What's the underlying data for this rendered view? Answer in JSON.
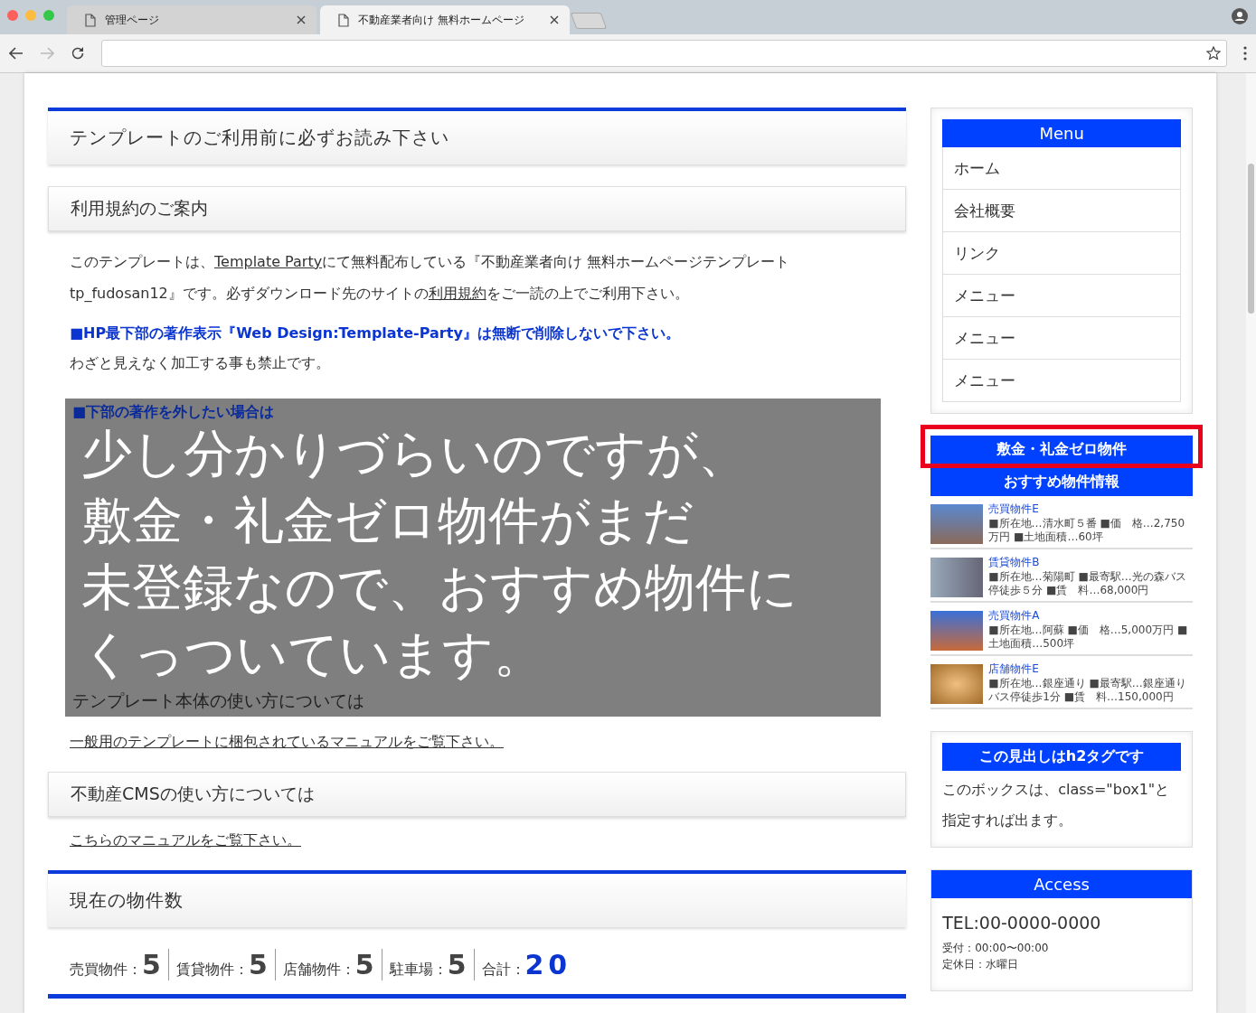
{
  "browser": {
    "tabs": [
      {
        "title": "管理ページ",
        "selected": false
      },
      {
        "title": "不動産業者向け 無料ホームページ",
        "selected": true
      }
    ]
  },
  "main": [
    {
      "kind": "h2",
      "text": "テンプレートのご利用前に必ずお読み下さい"
    },
    {
      "kind": "h3",
      "text": "利用規約のご案内"
    },
    {
      "kind": "p",
      "parts": [
        {
          "text": "このテンプレートは、",
          "link": false
        },
        {
          "text": "Template Party",
          "link": true
        },
        {
          "text": "にて無料配布している『不動産業者向け 無料ホームページテンプレート tp_fudosan12』です。必ずダウンロード先のサイトの",
          "link": false
        },
        {
          "text": "利用規約",
          "link": true
        },
        {
          "text": "をご一読の上でご利用下さい。",
          "link": false
        }
      ]
    },
    {
      "kind": "notice",
      "text": "■HP最下部の著作表示『Web Design:Template-Party』は無断で削除しないで下さい。"
    },
    {
      "kind": "p",
      "parts": [
        {
          "text": "わざと見えなく加工する事も禁止です。",
          "link": false
        }
      ]
    },
    {
      "kind": "overlay",
      "notice": "■下部の著作を外したい場合は",
      "heading": "テンプレート本体の使い方については",
      "caption": [
        "少し分かりづらいのですが、",
        "敷金・礼金ゼロ物件がまだ",
        "未登録なので、おすすめ物件に",
        "くっついています。"
      ]
    },
    {
      "kind": "link",
      "text": "一般用のテンプレートに梱包されているマニュアルをご覧下さい。"
    },
    {
      "kind": "h3",
      "text": "不動産CMSの使い方については"
    },
    {
      "kind": "link",
      "text": "こちらのマニュアルをご覧下さい。"
    },
    {
      "kind": "h2",
      "text": "現在の物件数"
    },
    {
      "kind": "stats",
      "items": [
        {
          "label": "売買物件：",
          "value": "5",
          "total": false
        },
        {
          "label": "賃貸物件：",
          "value": "5",
          "total": false
        },
        {
          "label": "店舗物件：",
          "value": "5",
          "total": false
        },
        {
          "label": "駐車場：",
          "value": "5",
          "total": false
        },
        {
          "label": "合計：",
          "value": "20",
          "total": true
        }
      ]
    }
  ],
  "sidebar": {
    "menu": {
      "title": "Menu",
      "items": [
        "ホーム",
        "会社概要",
        "リンク",
        "メニュー",
        "メニュー",
        "メニュー"
      ]
    },
    "featured": {
      "title": "敷金・礼金ゼロ物件",
      "highlighted": true
    },
    "recommended": {
      "title": "おすすめ物件情報",
      "items": [
        {
          "name": "売買物件E",
          "detail": "■所在地…清水町５番 ■価　格…2,750万円 ■土地面積…60坪"
        },
        {
          "name": "賃貸物件B",
          "detail": "■所在地…菊陽町 ■最寄駅…光の森バス停徒歩５分 ■賃　料…68,000円"
        },
        {
          "name": "売買物件A",
          "detail": "■所在地…阿蘇 ■価　格…5,000万円 ■土地面積…500坪"
        },
        {
          "name": "店舗物件E",
          "detail": "■所在地…銀座通り ■最寄駅…銀座通りバス停徒歩1分 ■賃　料…150,000円"
        }
      ]
    },
    "box1": {
      "title": "この見出しはh2タグです",
      "text": "このボックスは、class=\"box1\"と指定すれば出ます。"
    },
    "access": {
      "title": "Access",
      "tel": "TEL:00-0000-0000",
      "lines": [
        "受付：00:00〜00:00",
        "定休日：水曜日"
      ]
    }
  }
}
